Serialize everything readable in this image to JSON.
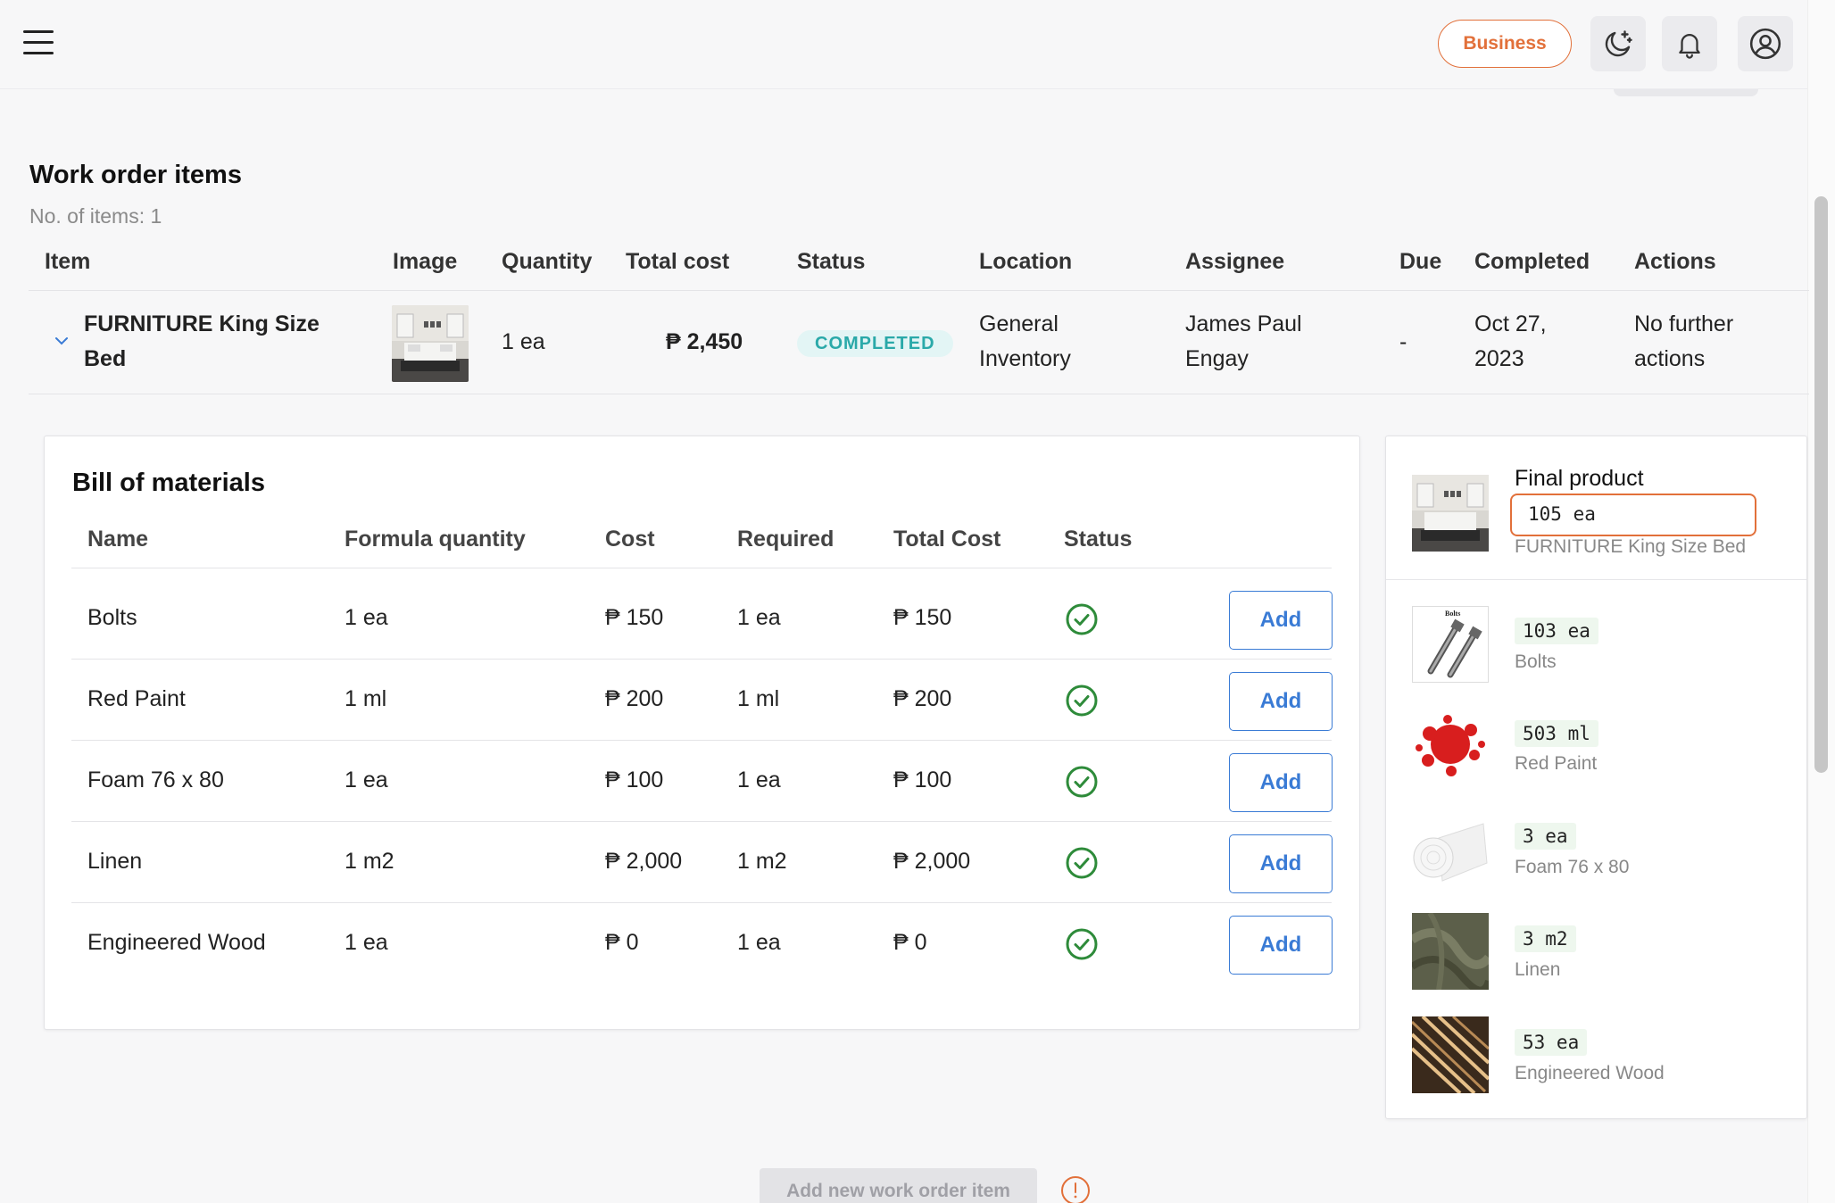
{
  "topbar": {
    "business_label": "Business",
    "icons": [
      "hamburger-menu-icon",
      "moon-icon",
      "bell-icon",
      "user-icon"
    ],
    "accent_color": "#e2703a"
  },
  "work_order": {
    "title": "Work order items",
    "item_count": "No. of items: 1",
    "columns": [
      "Item",
      "Image",
      "Quantity",
      "Total cost",
      "Status",
      "Location",
      "Assignee",
      "Due",
      "Completed",
      "Actions"
    ],
    "rows": [
      {
        "item_line1": "FURNITURE King Size",
        "item_line2": "Bed",
        "quantity": "1 ea",
        "total_cost": "₱ 2,450",
        "status": "COMPLETED",
        "location_line1": "General",
        "location_line2": "Inventory",
        "assignee_line1": "James Paul",
        "assignee_line2": "Engay",
        "due": "-",
        "completed_line1": "Oct 27,",
        "completed_line2": "2023",
        "actions_line1": "No further",
        "actions_line2": "actions"
      }
    ]
  },
  "bom": {
    "title": "Bill of materials",
    "columns": [
      "Name",
      "Formula quantity",
      "Cost",
      "Required",
      "Total Cost",
      "Status"
    ],
    "add_label": "Add",
    "rows": [
      {
        "name": "Bolts",
        "formula_qty": "1 ea",
        "cost": "₱ 150",
        "required": "1 ea",
        "total_cost": "₱ 150"
      },
      {
        "name": "Red Paint",
        "formula_qty": "1 ml",
        "cost": "₱ 200",
        "required": "1 ml",
        "total_cost": "₱ 200"
      },
      {
        "name": "Foam 76 x 80",
        "formula_qty": "1 ea",
        "cost": "₱ 100",
        "required": "1 ea",
        "total_cost": "₱ 100"
      },
      {
        "name": "Linen",
        "formula_qty": "1 m2",
        "cost": "₱ 2,000",
        "required": "1 m2",
        "total_cost": "₱ 2,000"
      },
      {
        "name": "Engineered Wood",
        "formula_qty": "1 ea",
        "cost": "₱ 0",
        "required": "1 ea",
        "total_cost": "₱ 0"
      }
    ]
  },
  "stock": {
    "final_product_label": "Final product",
    "final_product_qty": "105 ea",
    "final_product_name": "FURNITURE King Size Bed",
    "materials": [
      {
        "qty": "103 ea",
        "name": "Bolts"
      },
      {
        "qty": "503 ml",
        "name": "Red Paint"
      },
      {
        "qty": "3 ea",
        "name": "Foam 76 x 80"
      },
      {
        "qty": "3 m2",
        "name": "Linen"
      },
      {
        "qty": "53 ea",
        "name": "Engineered Wood"
      }
    ],
    "bolts_image_text": "Bolts"
  },
  "footer": {
    "add_work_order_label": "Add new work order item"
  }
}
